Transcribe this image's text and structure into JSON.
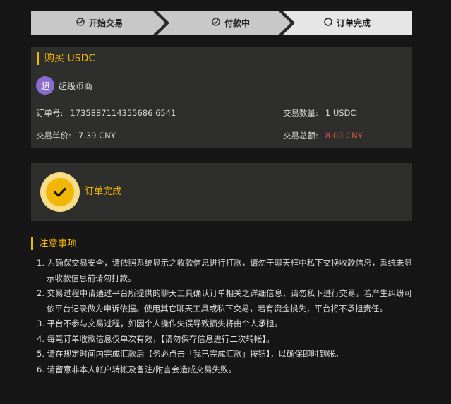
{
  "steps": [
    {
      "label": "开始交易",
      "icon": "check-circle-icon"
    },
    {
      "label": "付款中",
      "icon": "check-circle-icon"
    },
    {
      "label": "订单完成",
      "icon": "circle-icon"
    }
  ],
  "order": {
    "title": "购买 USDC",
    "merchant_avatar": "超",
    "merchant_name": "超级币商",
    "order_no_label": "订单号:",
    "order_no": "1735887114355686 6541",
    "quantity_label": "交易数量:",
    "quantity": "1 USDC",
    "price_label": "交易单价:",
    "price": "7.39 CNY",
    "total_label": "交易总额:",
    "total": "8.00 CNY"
  },
  "status": {
    "text": "订单完成"
  },
  "notes": {
    "title": "注意事项",
    "items": [
      "1. 为确保交易安全，请依照系统显示之收款信息进行打款，请勿于聊天框中私下交换收款信息，系统未显示收款信息前请勿打款。",
      "2. 交易过程中请通过平台所提供的聊天工具确认订单相关之详细信息，请勿私下进行交易，若产生纠纷可依平台记录做为申诉依据。使用其它聊天工具或私下交易，若有资金损失，平台将不承担责任。",
      "3. 平台不参与交易过程，如因个人操作失误导致损失将由个人承担。",
      "4. 每笔订单收款信息仅单次有效，【请勿保存信息进行二次转帐】。",
      "5. 请在规定时间内完成汇款后【务必点击「我已完成汇款」按钮】，以确保即时到帐。",
      "6. 请留意非本人帐户转帐及备注/附言会造成交易失败。"
    ]
  },
  "colors": {
    "accent": "#f2b705",
    "total": "#e0524c",
    "avatar": "#8a6ccf"
  }
}
